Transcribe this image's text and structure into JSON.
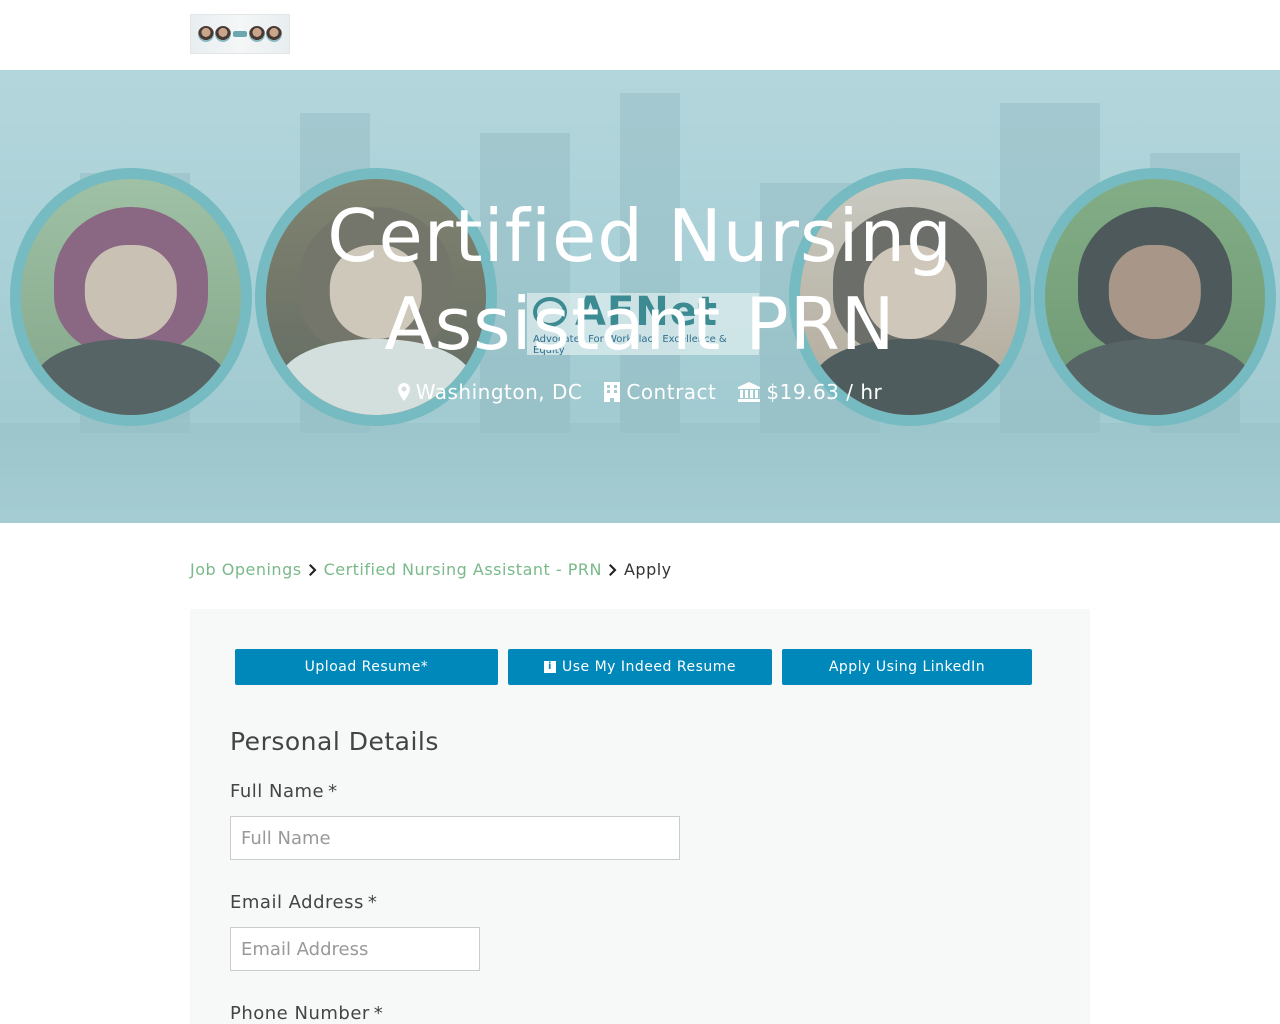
{
  "hero": {
    "title": "Certified Nursing Assistant PRN",
    "logo_mark": "AFNet",
    "logo_tagline": "Advocates For Workplace Excellence & Equity",
    "location": "Washington, DC",
    "job_type": "Contract",
    "pay": "$19.63 / hr"
  },
  "breadcrumb": {
    "items": [
      {
        "label": "Job Openings"
      },
      {
        "label": "Certified Nursing Assistant - PRN"
      }
    ],
    "current": "Apply"
  },
  "apply_buttons": {
    "upload_resume": "Upload Resume*",
    "indeed": "Use My Indeed Resume",
    "linkedin": "Apply Using LinkedIn"
  },
  "form": {
    "section_title": "Personal Details",
    "required_mark": "*",
    "full_name": {
      "label": "Full Name",
      "placeholder": "Full Name",
      "value": ""
    },
    "email": {
      "label": "Email Address",
      "placeholder": "Email Address",
      "value": ""
    },
    "phone": {
      "label": "Phone Number"
    }
  },
  "colors": {
    "accent": "#0088bb",
    "breadcrumb_link": "#7ab98a",
    "portrait_ring": "#5ab0b6"
  }
}
